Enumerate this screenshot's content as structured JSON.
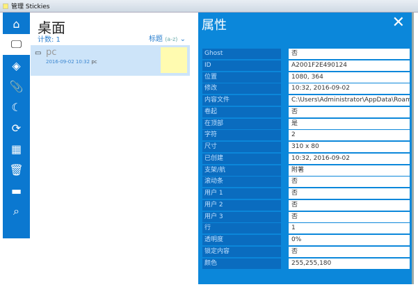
{
  "window": {
    "title": "管理 Stickies"
  },
  "sidebar": {
    "items": [
      {
        "name": "home",
        "icon": "⌂"
      },
      {
        "name": "desktop",
        "icon": "🖵"
      },
      {
        "name": "layers",
        "icon": "◈"
      },
      {
        "name": "attachment",
        "icon": "📎"
      },
      {
        "name": "night",
        "icon": "☾"
      },
      {
        "name": "repeat",
        "icon": "⟳"
      },
      {
        "name": "calendar",
        "icon": "▦"
      },
      {
        "name": "trash",
        "icon": "🗑"
      },
      {
        "name": "folder",
        "icon": "▬"
      },
      {
        "name": "search",
        "icon": "⌕"
      }
    ]
  },
  "list": {
    "title": "桌面",
    "count": "计数: 1",
    "sort_label": "标题",
    "sort_order": "(a-z)",
    "sort_icon": "⌄",
    "items": [
      {
        "name": "pc",
        "meta_date": "2016-09-02 10:32",
        "meta_host": "pc",
        "icon": "▭"
      }
    ]
  },
  "properties": {
    "title": "属性",
    "close": "✕",
    "rows": [
      {
        "label": "Ghost",
        "value": "否"
      },
      {
        "label": "ID",
        "value": "A2001F2E490124"
      },
      {
        "label": "位置",
        "value": "1080, 364"
      },
      {
        "label": "修改",
        "value": "10:32, 2016-09-02"
      },
      {
        "label": "内容文件",
        "value": "C:\\Users\\Administrator\\AppData\\Roaming"
      },
      {
        "label": "卷起",
        "value": "否"
      },
      {
        "label": "在顶部",
        "value": "是"
      },
      {
        "label": "字符",
        "value": "2"
      },
      {
        "label": "尺寸",
        "value": "310 x 80"
      },
      {
        "label": "已创建",
        "value": "10:32, 2016-09-02"
      },
      {
        "label": "支架/航",
        "value": "附著"
      },
      {
        "label": "滚动条",
        "value": "否"
      },
      {
        "label": "用户 1",
        "value": "否"
      },
      {
        "label": "用户 2",
        "value": "否"
      },
      {
        "label": "用户 3",
        "value": "否"
      },
      {
        "label": "行",
        "value": "1"
      },
      {
        "label": "透明度",
        "value": "0%"
      },
      {
        "label": "锁定内容",
        "value": "否"
      },
      {
        "label": "颜色",
        "value": "255,255,180"
      }
    ]
  },
  "colors": {
    "accent": "#0b87da",
    "sidebar": "#0b78d0",
    "label_bg": "#0a6cbf",
    "note": "#fffbb0"
  }
}
